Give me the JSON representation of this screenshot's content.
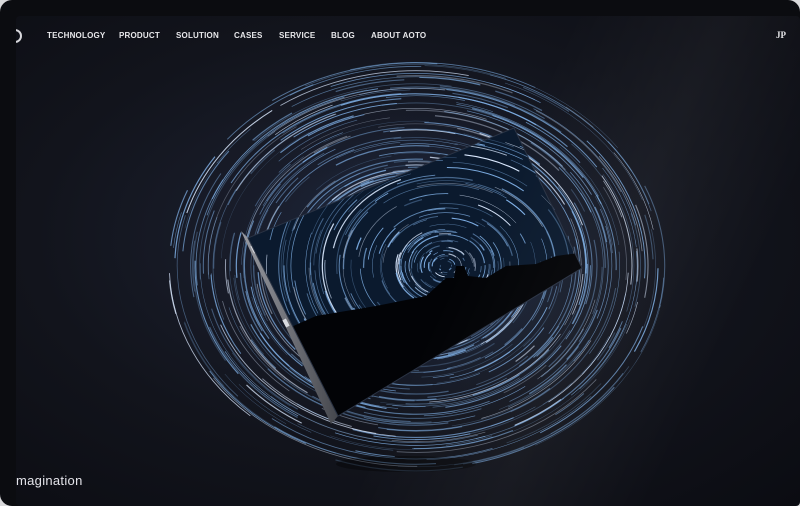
{
  "nav": {
    "items": [
      {
        "label": "TECHNOLOGY"
      },
      {
        "label": "PRODUCT"
      },
      {
        "label": "SOLUTION"
      },
      {
        "label": "CASES"
      },
      {
        "label": "SERVICE"
      },
      {
        "label": "BLOG"
      },
      {
        "label": "ABOUT AOTO"
      }
    ],
    "language": "JP"
  },
  "hero": {
    "tagline": "magination"
  },
  "colors": {
    "background": "#12141c",
    "star_trail": "#7fb0e6",
    "nav_text": "#e7e7ea"
  },
  "icons": {
    "logo": "aoto-logo-partial"
  }
}
